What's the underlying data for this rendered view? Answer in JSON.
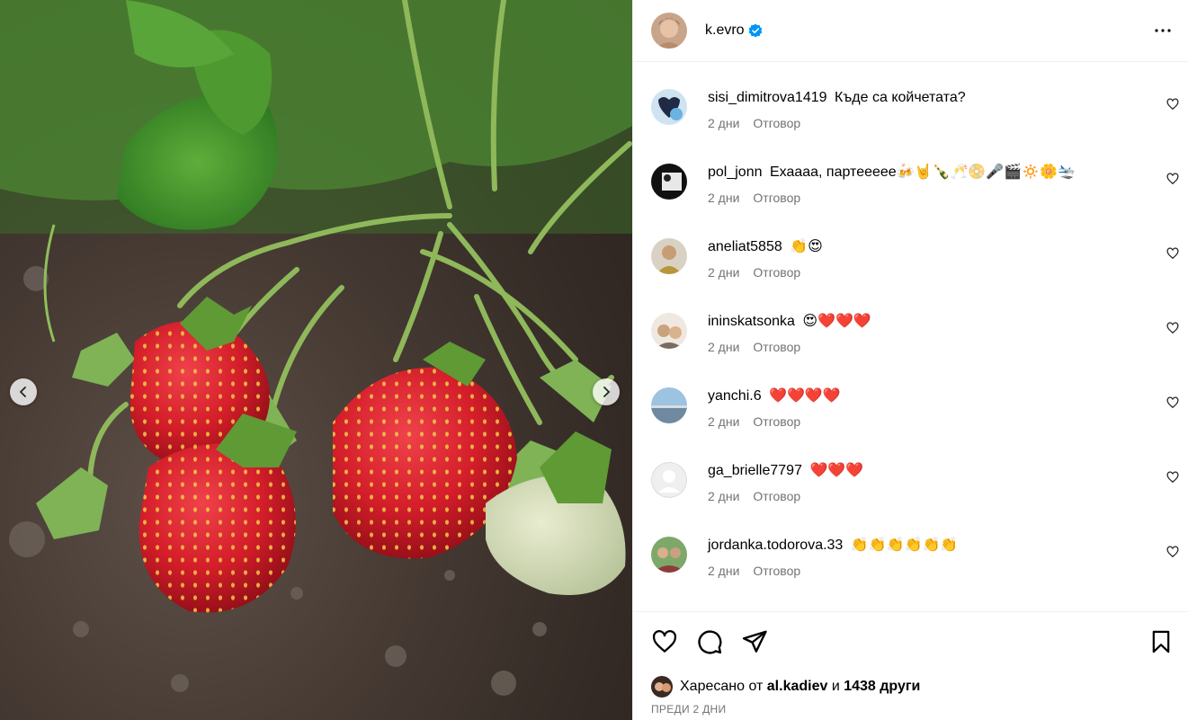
{
  "post": {
    "author": "k.evro",
    "verified": true,
    "image_alt": "strawberries-photo"
  },
  "icons": {
    "verified": "verified-badge-icon",
    "more": "more-options-icon",
    "like": "heart-icon",
    "comment": "comment-icon",
    "share": "send-icon",
    "save": "bookmark-icon",
    "prev": "chevron-left-icon",
    "next": "chevron-right-icon"
  },
  "colors": {
    "verified": "#0095f6",
    "muted": "#737373"
  },
  "comments": [
    {
      "user": "sisi_dimitrova1419",
      "text": "Къде са койчетата?",
      "time": "2 дни",
      "reply": "Отговор"
    },
    {
      "user": "pol_jonn",
      "text": "Ехаааа, партеееее🍻🤘🍾🥂📀🎤🎬🔅🌼🛬",
      "time": "2 дни",
      "reply": "Отговор"
    },
    {
      "user": "aneliat5858",
      "text": "👏😍",
      "time": "2 дни",
      "reply": "Отговор"
    },
    {
      "user": "ininskatsonka",
      "text": "😍❤️❤️❤️",
      "time": "2 дни",
      "reply": "Отговор"
    },
    {
      "user": "yanchi.6",
      "text": "❤️❤️❤️❤️",
      "time": "2 дни",
      "reply": "Отговор"
    },
    {
      "user": "ga_brielle7797",
      "text": "❤️❤️❤️",
      "time": "2 дни",
      "reply": "Отговор"
    },
    {
      "user": "jordanka.todorova.33",
      "text": "👏👏👏👏👏👏",
      "time": "2 дни",
      "reply": "Отговор"
    }
  ],
  "likes": {
    "prefix": "Харесано от",
    "user": "al.kadiev",
    "conj": "и",
    "others": "1438 други"
  },
  "timestamp": "ПРЕДИ 2 ДНИ"
}
